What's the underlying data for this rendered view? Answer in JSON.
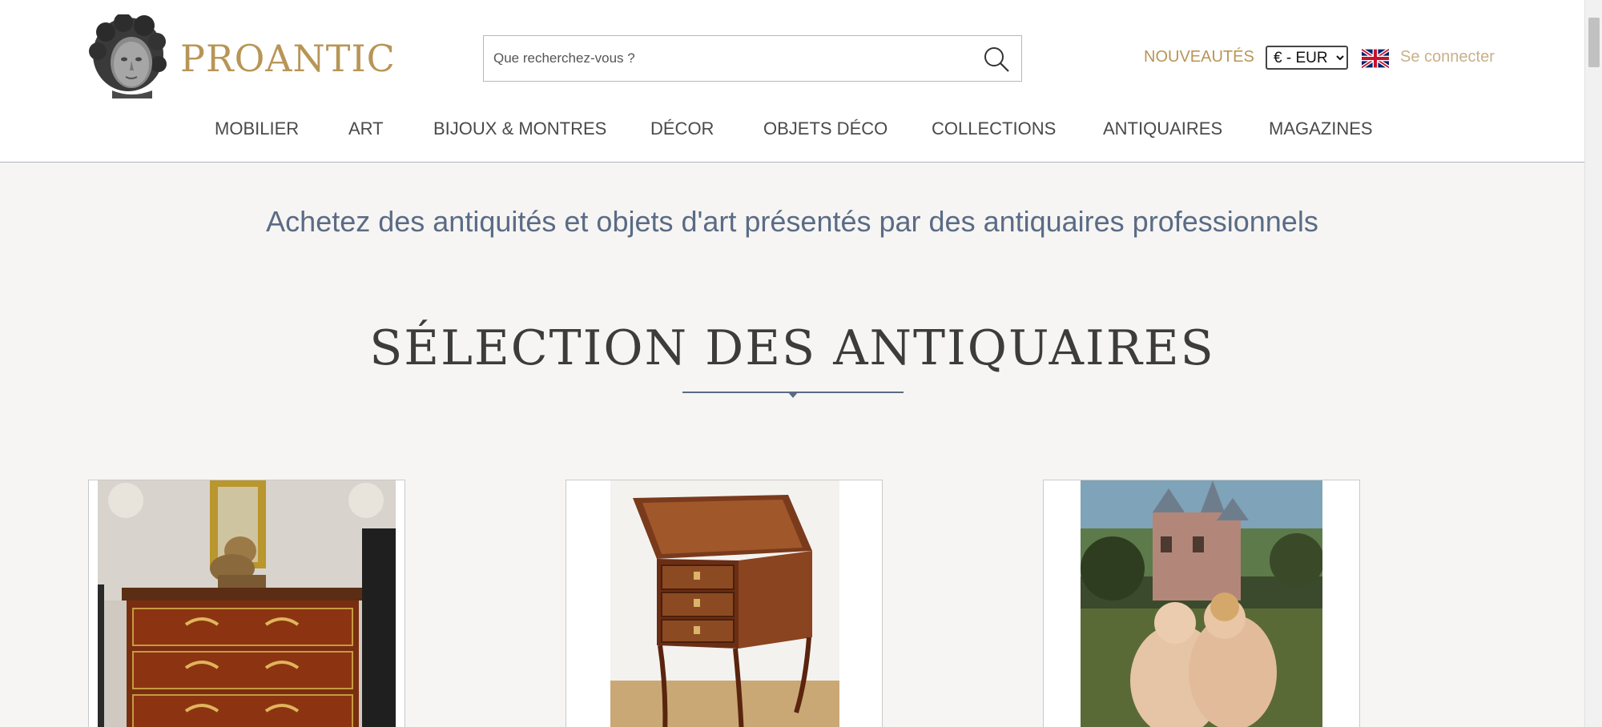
{
  "header": {
    "brand": "PROANTIC",
    "search_placeholder": "Que recherchez-vous ?",
    "new_link": "NOUVEAUTÉS",
    "currency_selected": "€ - EUR",
    "login_link": "Se connecter",
    "accent_color": "#b89556"
  },
  "nav": {
    "items": [
      "MOBILIER",
      "ART",
      "BIJOUX & MONTRES",
      "DÉCOR",
      "OBJETS DÉCO",
      "COLLECTIONS",
      "ANTIQUAIRES",
      "MAGAZINES"
    ]
  },
  "main": {
    "tagline": "Achetez des antiquités et objets d'art présentés par des antiquaires professionnels",
    "section_title": "SÉLECTION DES ANTIQUAIRES",
    "products": [
      {
        "image": "commode-with-putto-photo"
      },
      {
        "image": "side-table-photo"
      },
      {
        "image": "painting-kissing-children-photo"
      }
    ]
  }
}
